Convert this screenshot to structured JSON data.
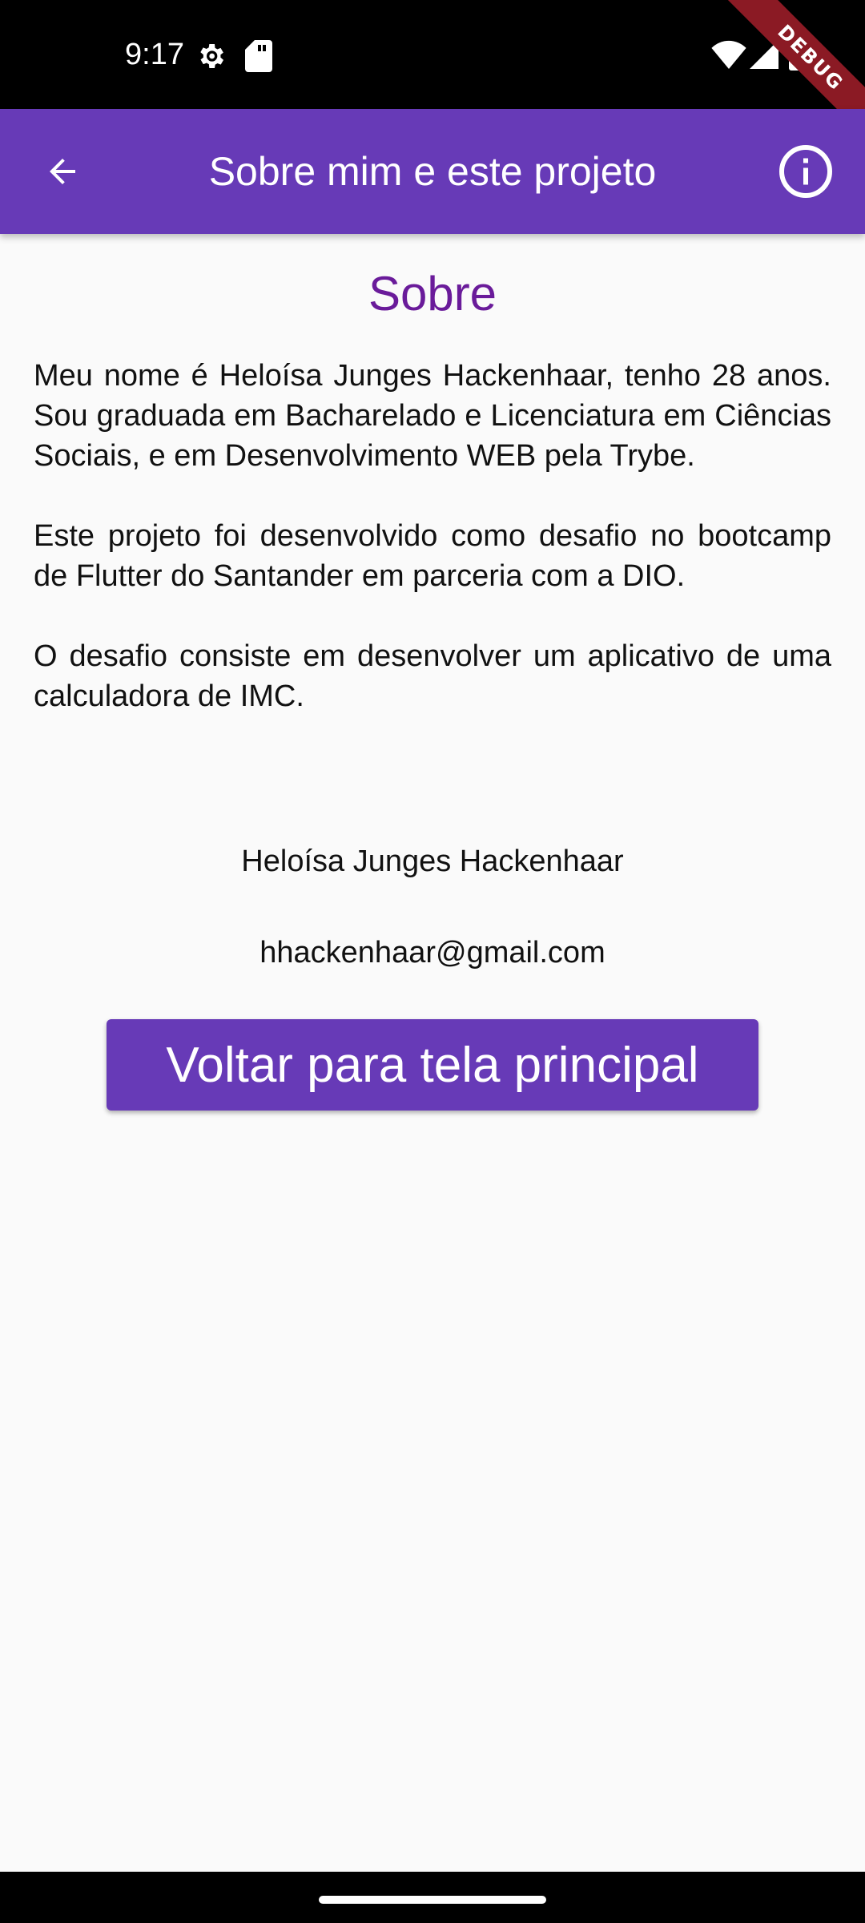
{
  "status_bar": {
    "time": "9:17",
    "icons": [
      "settings-gear-icon",
      "sd-card-icon",
      "wifi-icon",
      "signal-icon",
      "battery-icon"
    ],
    "debug_label": "DEBUG"
  },
  "app_bar": {
    "back_icon": "arrow-back-icon",
    "title": "Sobre mim e este projeto",
    "info_icon": "info-outline-icon",
    "background_color": "#673ab7"
  },
  "content": {
    "section_title": "Sobre",
    "section_title_color": "#6a1b9a",
    "paragraphs": [
      "Meu nome é Heloísa Junges Hackenhaar, tenho 28 anos. Sou graduada em Bacharelado e Licenciatura em Ciências Sociais, e em Desenvolvimento WEB pela Trybe.",
      "Este projeto foi desenvolvido como desafio no bootcamp de Flutter do Santander em parceria com a DIO.",
      "O desafio consiste em desenvolver um aplicativo de uma calculadora de IMC."
    ],
    "author_name": "Heloísa Junges Hackenhaar",
    "author_email": "hhackenhaar@gmail.com",
    "back_button_label": "Voltar para tela principal"
  }
}
